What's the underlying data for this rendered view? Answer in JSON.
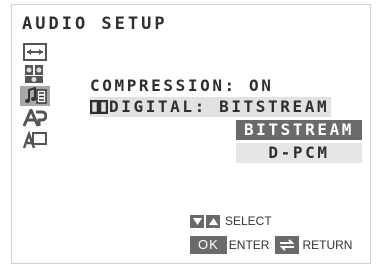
{
  "title": "AUDIO SETUP",
  "menu_icons": [
    {
      "name": "general-setup-icon",
      "selected": false
    },
    {
      "name": "speaker-setup-icon",
      "selected": false
    },
    {
      "name": "audio-setup-icon",
      "selected": true
    },
    {
      "name": "preference-setup-icon",
      "selected": false
    },
    {
      "name": "video-setup-icon",
      "selected": false
    }
  ],
  "settings": {
    "compression": "COMPRESSION: ON",
    "digital": "DIGITAL: BITSTREAM"
  },
  "options": {
    "selected": "BITSTREAM",
    "other": "D-PCM"
  },
  "hints": {
    "select": "SELECT",
    "ok": "OK",
    "enter": "ENTER",
    "return": "RETURN"
  }
}
